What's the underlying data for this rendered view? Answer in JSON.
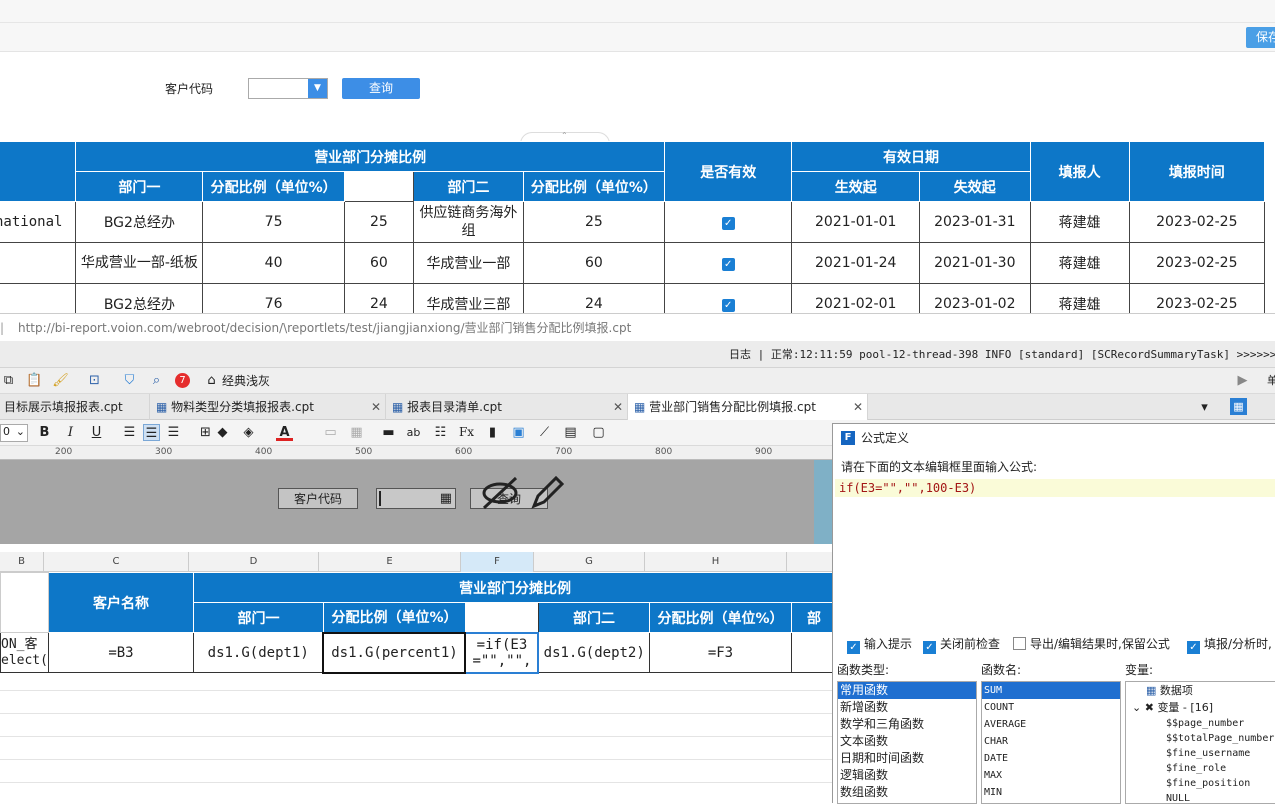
{
  "preview": {
    "save_label": "保存",
    "filter_label": "客户代码",
    "query_label": "查询",
    "table": {
      "group_header": "营业部门分摊比例",
      "col_dept1": "部门一",
      "col_ratio1": "分配比例（单位%）",
      "col_dept2": "部门二",
      "col_ratio2": "分配比例（单位%）",
      "col_valid": "是否有效",
      "col_date_group": "有效日期",
      "col_start": "生效起",
      "col_end": "失效起",
      "col_reporter": "填报人",
      "col_time": "填报时间",
      "rows": [
        {
          "c1": "national",
          "dept1": "BG2总经办",
          "r1": "75",
          "rem": "25",
          "dept2": "供应链商务海外组",
          "r2": "25",
          "start": "2021-01-01",
          "end": "2023-01-31",
          "rep": "蒋建雄",
          "time": "2023-02-25"
        },
        {
          "c1": "",
          "dept1": "华成营业一部-纸板",
          "r1": "40",
          "rem": "60",
          "dept2": "华成营业一部",
          "r2": "60",
          "start": "2021-01-24",
          "end": "2021-01-30",
          "rep": "蒋建雄",
          "time": "2023-02-25"
        },
        {
          "c1": "",
          "dept1": "BG2总经办",
          "r1": "76",
          "rem": "24",
          "dept2": "华成营业三部",
          "r2": "24",
          "start": "2021-02-01",
          "end": "2023-01-02",
          "rep": "蒋建雄",
          "time": "2023-02-25"
        }
      ]
    }
  },
  "designer": {
    "url": "http://bi-report.voion.com/webroot/decision/\\reportlets/test/jiangjianxiong/营业部门销售分配比例填报.cpt",
    "log": "日志 | 正常:12:11:59 pool-12-thread-398 INFO [standard] [SCRecordSummaryTask] >>>>>>>>>>",
    "toolbar_theme": "经典浅灰",
    "badge_count": "7",
    "tabs": [
      {
        "label": "目标展示填报报表.cpt",
        "active": false
      },
      {
        "label": "物料类型分类填报报表.cpt",
        "active": false
      },
      {
        "label": "报表目录清单.cpt",
        "active": false
      },
      {
        "label": "营业部门销售分配比例填报.cpt",
        "active": true
      }
    ],
    "font_size": "0",
    "ruler": [
      "200",
      "300",
      "400",
      "500",
      "600",
      "700",
      "800",
      "900"
    ],
    "canvas": {
      "label": "客户代码",
      "button": "查询"
    },
    "col_headers": [
      "B",
      "C",
      "D",
      "E",
      "F",
      "G",
      "H"
    ],
    "grid": {
      "cust_name": "客户名称",
      "group_header": "营业部门分摊比例",
      "dept1": "部门一",
      "ratio1": "分配比例（单位%）",
      "dept2": "部门二",
      "ratio2": "分配比例（单位%）",
      "dept3": "部",
      "b_cell_1": "ON_客",
      "b_cell_2": "elect(",
      "c_cell": "=B3",
      "d_cell": "ds1.G(dept1)",
      "e_cell": "ds1.G(percent1)",
      "f_cell_1": "=if(E3",
      "f_cell_2": "=\"\",\"\",",
      "g_cell": "ds1.G(dept2)",
      "h_cell": "=F3"
    }
  },
  "formula_dialog": {
    "title": "公式定义",
    "hint": "请在下面的文本编辑框里面输入公式:",
    "formula": "if(E3=\"\",\"\",100-E3)",
    "options": [
      {
        "label": "输入提示",
        "checked": true
      },
      {
        "label": "关闭前检查",
        "checked": true
      },
      {
        "label": "导出/编辑结果时,保留公式",
        "checked": false
      },
      {
        "label": "填报/分析时,",
        "checked": true
      }
    ],
    "func_type_title": "函数类型:",
    "func_types": [
      "常用函数",
      "新增函数",
      "数学和三角函数",
      "文本函数",
      "日期和时间函数",
      "逻辑函数",
      "数组函数"
    ],
    "func_name_title": "函数名:",
    "func_names": [
      "SUM",
      "COUNT",
      "AVERAGE",
      "CHAR",
      "DATE",
      "MAX",
      "MIN"
    ],
    "var_title": "变量:",
    "var_root": "数据项",
    "var_group": "变量 - [16]",
    "vars": [
      "$$page_number",
      "$$totalPage_number",
      "$fine_username",
      "$fine_role",
      "$fine_position",
      "NULL"
    ]
  },
  "colors": {
    "header_blue": "#0d77c8",
    "button_blue": "#3d8ee6",
    "selection": "#1f6fd0"
  }
}
